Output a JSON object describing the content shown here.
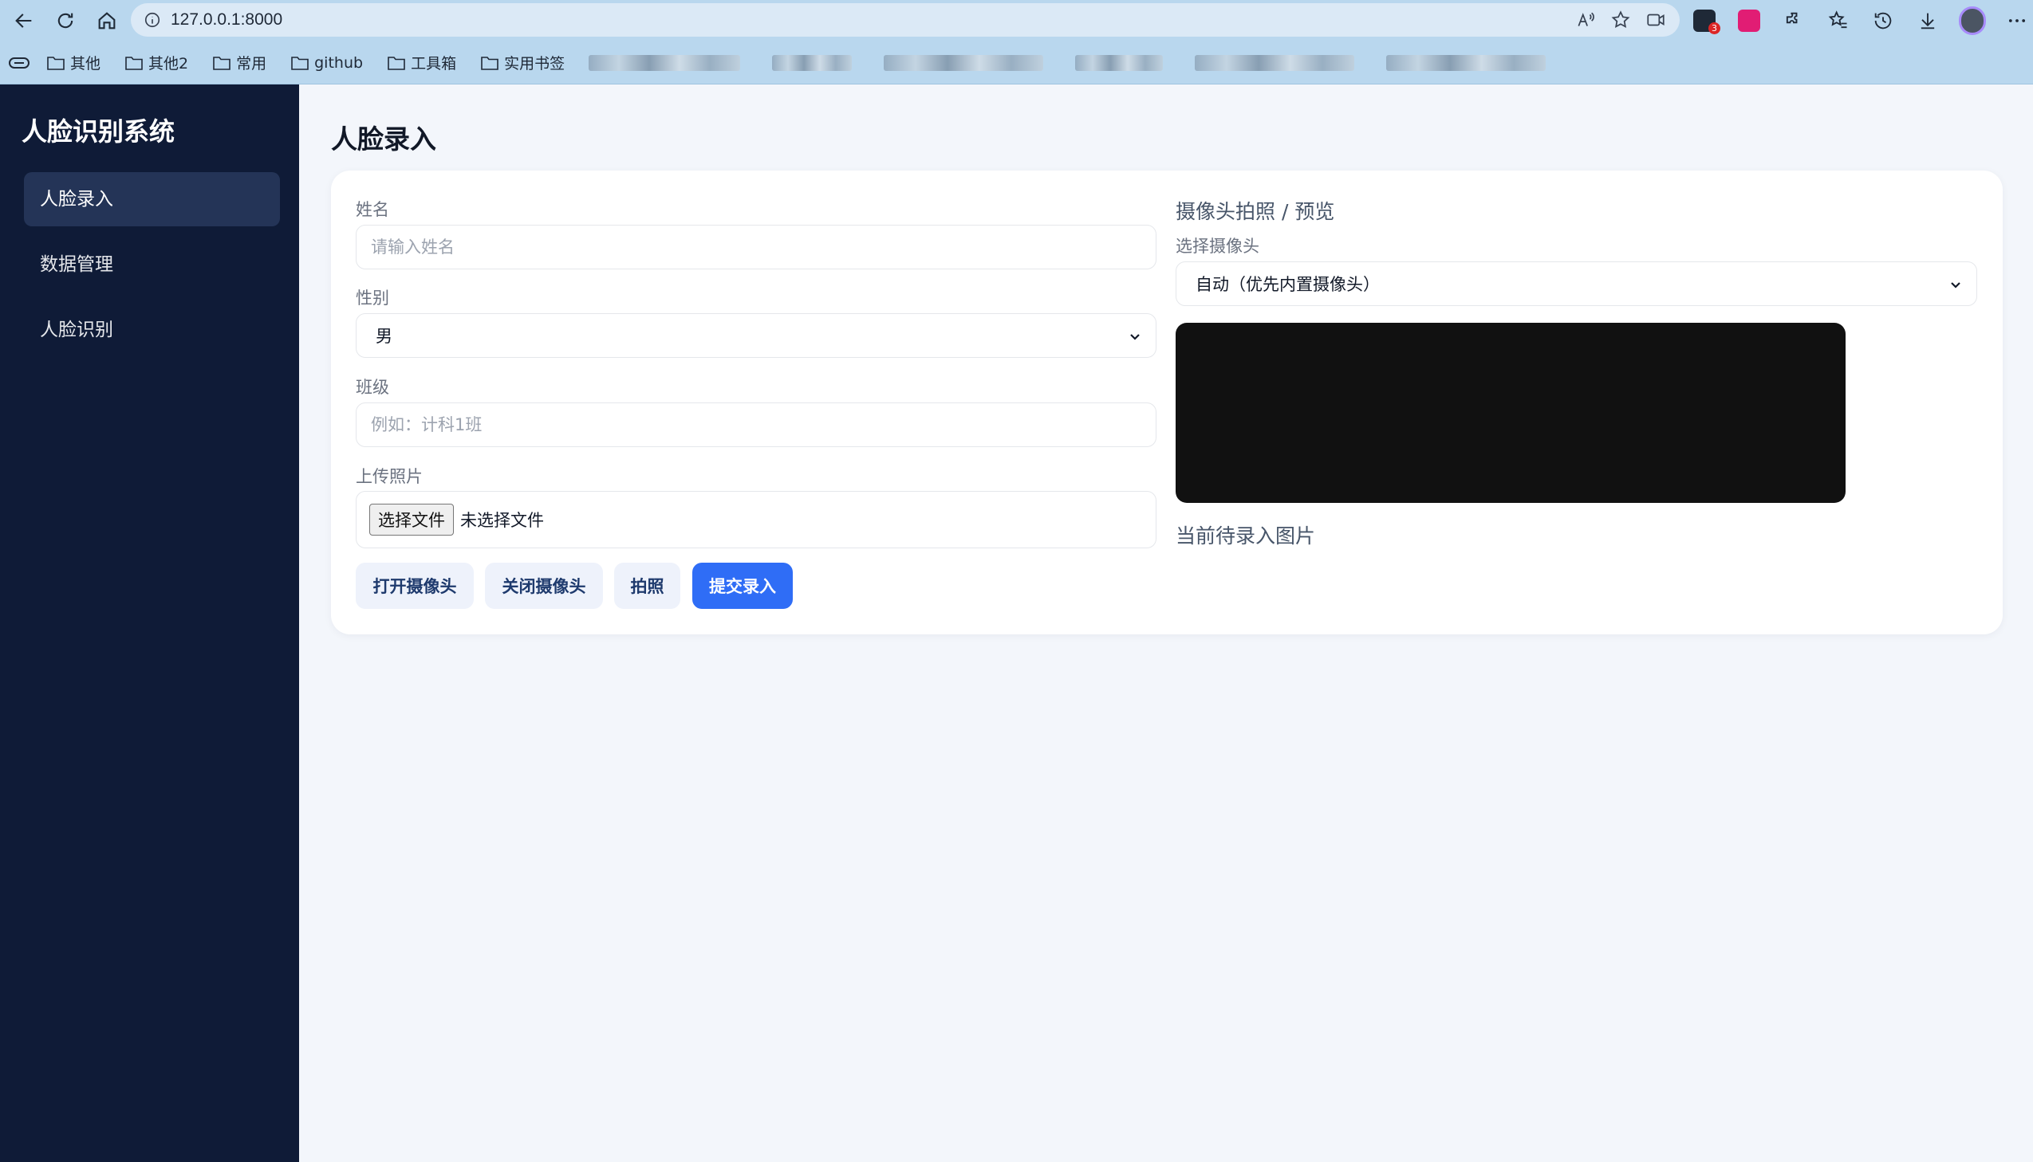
{
  "browser": {
    "url": "127.0.0.1:8000",
    "bookmarks": [
      "其他",
      "其他2",
      "常用",
      "github",
      "工具箱",
      "实用书签"
    ],
    "extension_badge": "3"
  },
  "sidebar": {
    "brand": "人脸识别系统",
    "items": [
      {
        "label": "人脸录入",
        "active": true
      },
      {
        "label": "数据管理",
        "active": false
      },
      {
        "label": "人脸识别",
        "active": false
      }
    ]
  },
  "page": {
    "title": "人脸录入"
  },
  "form": {
    "name_label": "姓名",
    "name_placeholder": "请输入姓名",
    "name_value": "",
    "gender_label": "性别",
    "gender_value": "男",
    "class_label": "班级",
    "class_placeholder": "例如：计科1班",
    "class_value": "",
    "photo_label": "上传照片",
    "file_button": "选择文件",
    "file_status": "未选择文件"
  },
  "buttons": {
    "open_camera": "打开摄像头",
    "close_camera": "关闭摄像头",
    "capture": "拍照",
    "submit": "提交录入"
  },
  "camera": {
    "section_title": "摄像头拍照 / 预览",
    "select_label": "选择摄像头",
    "select_value": "自动（优先内置摄像头）",
    "preview_caption": "当前待录入图片"
  },
  "colors": {
    "sidebar_bg": "#0f1b37",
    "sidebar_active": "#243457",
    "primary": "#2f6df6",
    "secondary_btn": "#eef2fb",
    "page_bg": "#f3f6fb"
  }
}
